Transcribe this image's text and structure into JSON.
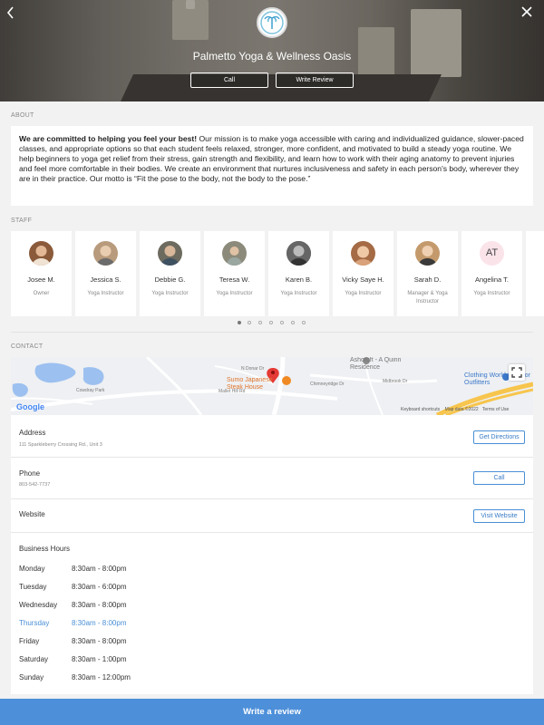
{
  "header": {
    "business_name": "Palmetto Yoga & Wellness Oasis",
    "call_label": "Call",
    "write_review_label": "Write Review"
  },
  "about": {
    "section_label": "ABOUT",
    "headline": "We are committed to helping you feel your best!",
    "body": " Our mission is to make yoga accessible with caring and individualized guidance, slower-paced classes, and appropriate options so that each student feels relaxed, stronger, more confident, and motivated to build a steady yoga routine. We help beginners to yoga get relief from their stress, gain strength and flexibility, and learn how to work with their aging anatomy to prevent injuries and feel more comfortable in their bodies. We create an environment that nurtures inclusiveness and safety in each person's body, wherever they are in their practice. Our motto is “Fit the pose to the body, not the body to the pose.”"
  },
  "staff": {
    "section_label": "STAFF",
    "members": [
      {
        "name": "Josee M.",
        "role": "Owner",
        "avatar_color": "#8a5a3a"
      },
      {
        "name": "Jessica S.",
        "role": "Yoga Instructor",
        "avatar_color": "#b89a7c"
      },
      {
        "name": "Debbie G.",
        "role": "Yoga Instructor",
        "avatar_color": "#6d6a5f"
      },
      {
        "name": "Teresa W.",
        "role": "Yoga Instructor",
        "avatar_color": "#8c8a7a"
      },
      {
        "name": "Karen B.",
        "role": "Yoga Instructor",
        "avatar_color": "#555555"
      },
      {
        "name": "Vicky Saye H.",
        "role": "Yoga Instructor",
        "avatar_color": "#a56b45"
      },
      {
        "name": "Sarah D.",
        "role": "Manager & Yoga Instructor",
        "avatar_color": "#c49a6c"
      },
      {
        "name": "Angelina T.",
        "role": "Yoga Instructor",
        "initials": "AT"
      }
    ],
    "page_count": 6,
    "active_page": 1
  },
  "contact": {
    "section_label": "CONTACT",
    "map": {
      "poi_restaurant": "Sumo Japanese Steak House",
      "poi_residence": "Ashcroft - A Quinn Residence",
      "poi_store": "Clothing World Outdoor Outfitters",
      "street_1": "Mallet Hill Rd",
      "street_2": "Cowdray Park",
      "street_3": "Chimneyridge Dr",
      "street_4": "Midbrook Dr",
      "street_5": "N Donar Dr",
      "google": "Google",
      "keyboard": "Keyboard shortcuts",
      "map_data": "Map data ©2022",
      "terms": "Terms of Use"
    },
    "address_label": "Address",
    "address_value": "111 Sparkleberry Crossing Rd., Unit 3",
    "directions_label": "Get Directions",
    "phone_label": "Phone",
    "phone_value": "803-542-7737",
    "phone_button": "Call",
    "website_label": "Website",
    "website_button": "Visit Website",
    "hours_title": "Business Hours",
    "hours": [
      {
        "day": "Monday",
        "time": "8:30am - 8:00pm"
      },
      {
        "day": "Tuesday",
        "time": "8:30am - 6:00pm"
      },
      {
        "day": "Wednesday",
        "time": "8:30am - 8:00pm"
      },
      {
        "day": "Thursday",
        "time": "8:30am - 8:00pm",
        "today": true
      },
      {
        "day": "Friday",
        "time": "8:30am - 8:00pm"
      },
      {
        "day": "Saturday",
        "time": "8:30am - 1:00pm"
      },
      {
        "day": "Sunday",
        "time": "8:30am - 12:00pm"
      }
    ],
    "today_color": "#4a8fd6"
  },
  "footer": {
    "write_review_label": "Write a review"
  },
  "colors": {
    "accent": "#4d8fd9"
  }
}
